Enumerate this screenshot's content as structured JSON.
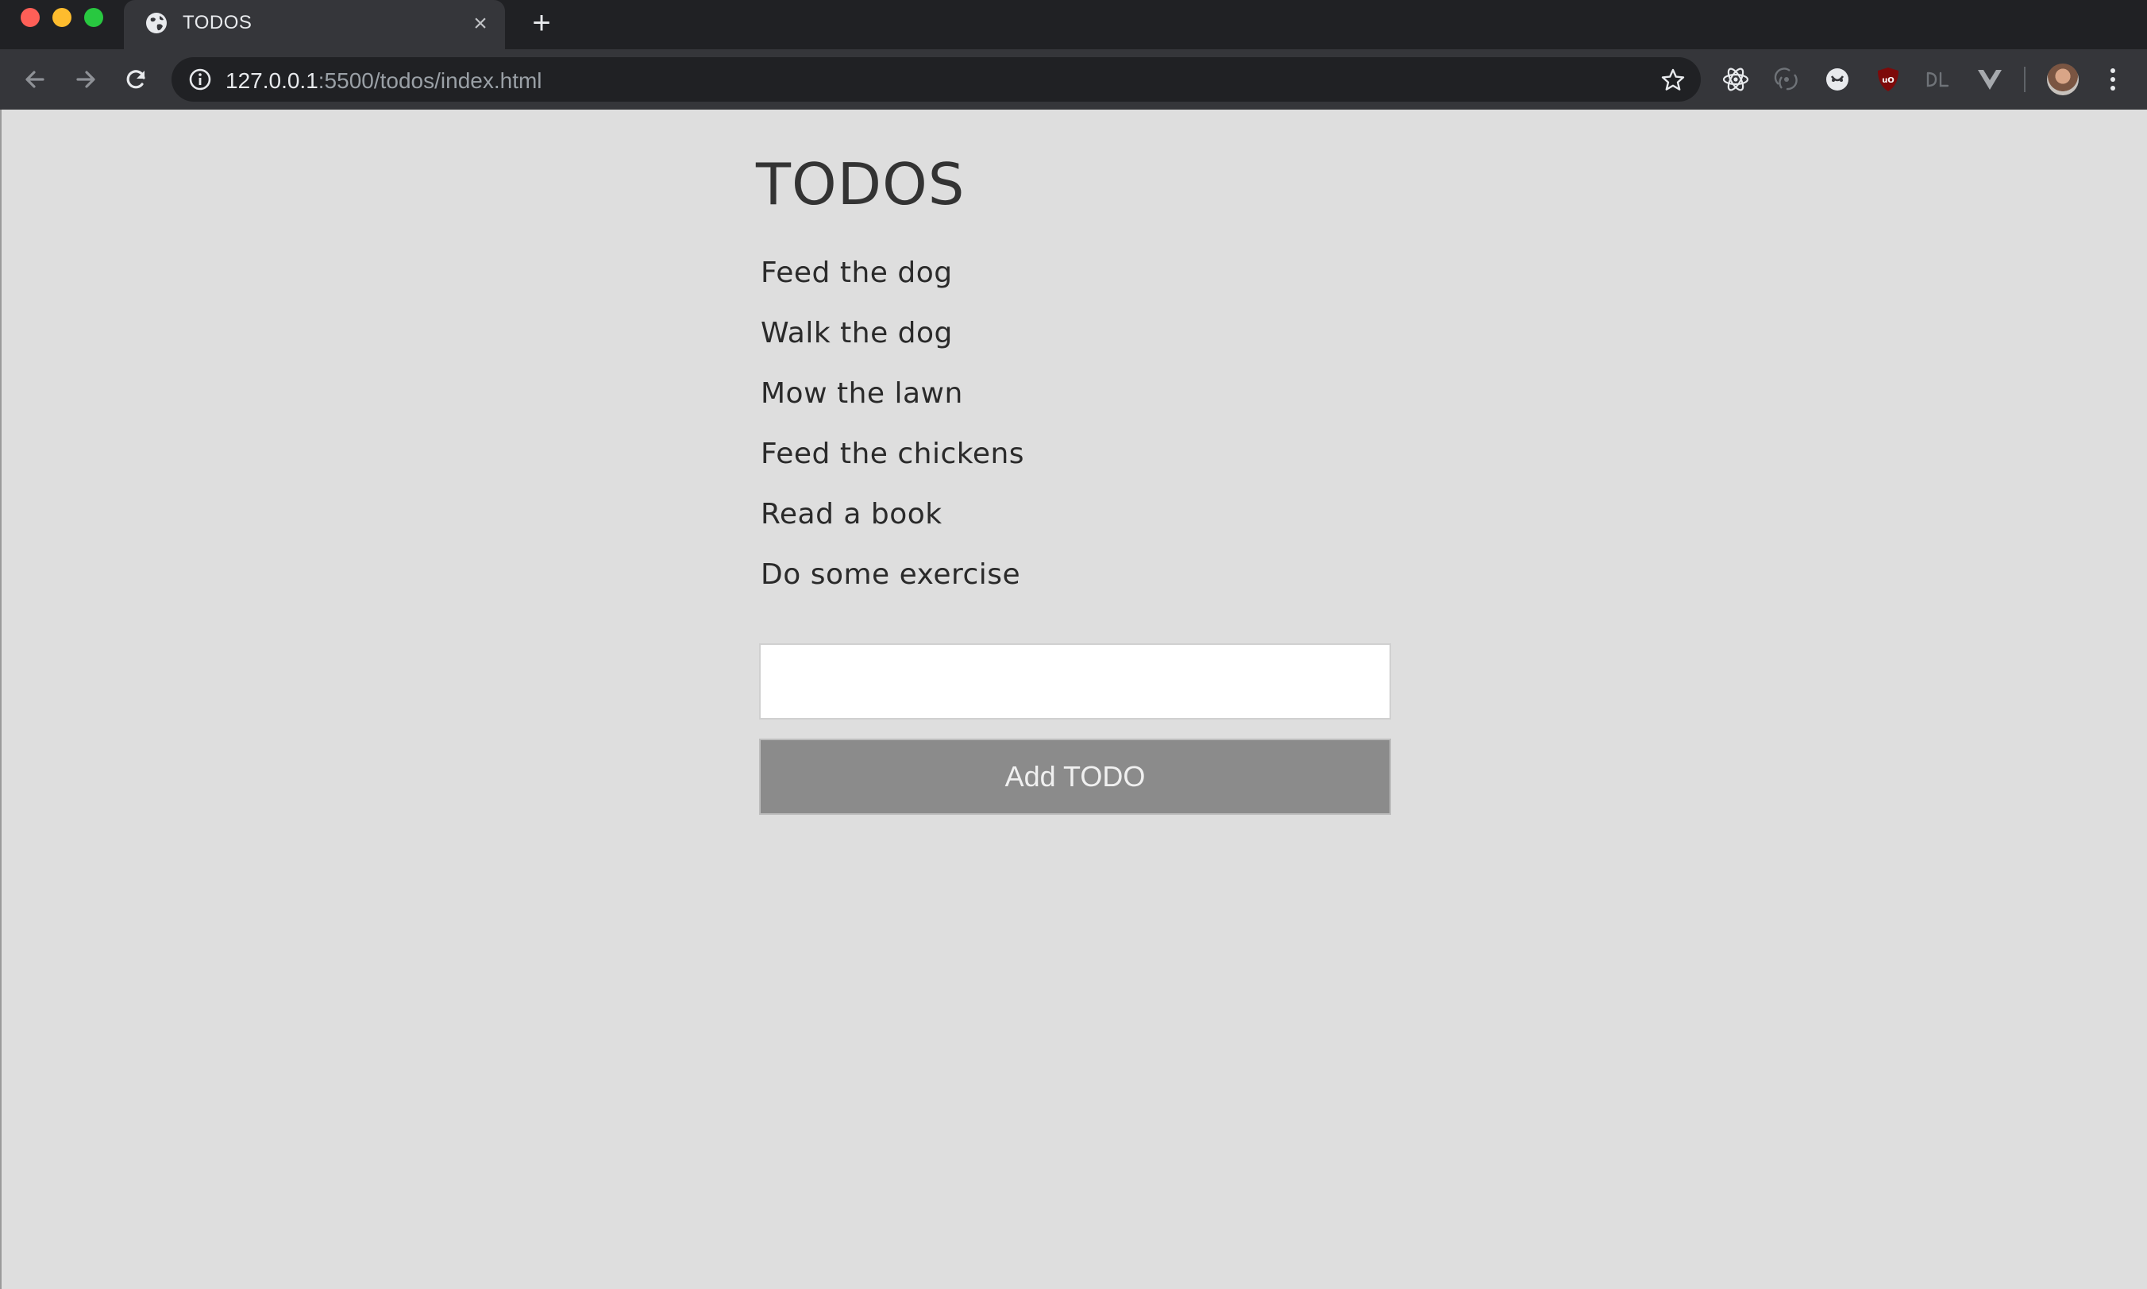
{
  "browser": {
    "tab": {
      "title": "TODOS",
      "close_glyph": "×",
      "favicon": "globe-icon"
    },
    "new_tab_glyph": "+",
    "address": {
      "host": "127.0.0.1",
      "rest": ":5500/todos/index.html"
    },
    "extension_icons": [
      "react-devtools-icon",
      "redux-devtools-icon",
      "privacy-badger-icon",
      "ublock-origin-icon",
      "dl-extension-icon",
      "vue-devtools-icon"
    ]
  },
  "app": {
    "title": "TODOS",
    "todos": [
      "Feed the dog",
      "Walk the dog",
      "Mow the lawn",
      "Feed the chickens",
      "Read a book",
      "Do some exercise"
    ],
    "input": {
      "value": "",
      "placeholder": ""
    },
    "add_button_label": "Add TODO"
  },
  "colors": {
    "page_background": "#dedede",
    "button_background": "#8b8b8b",
    "chrome_dark": "#202124",
    "chrome_toolbar": "#35363a"
  }
}
